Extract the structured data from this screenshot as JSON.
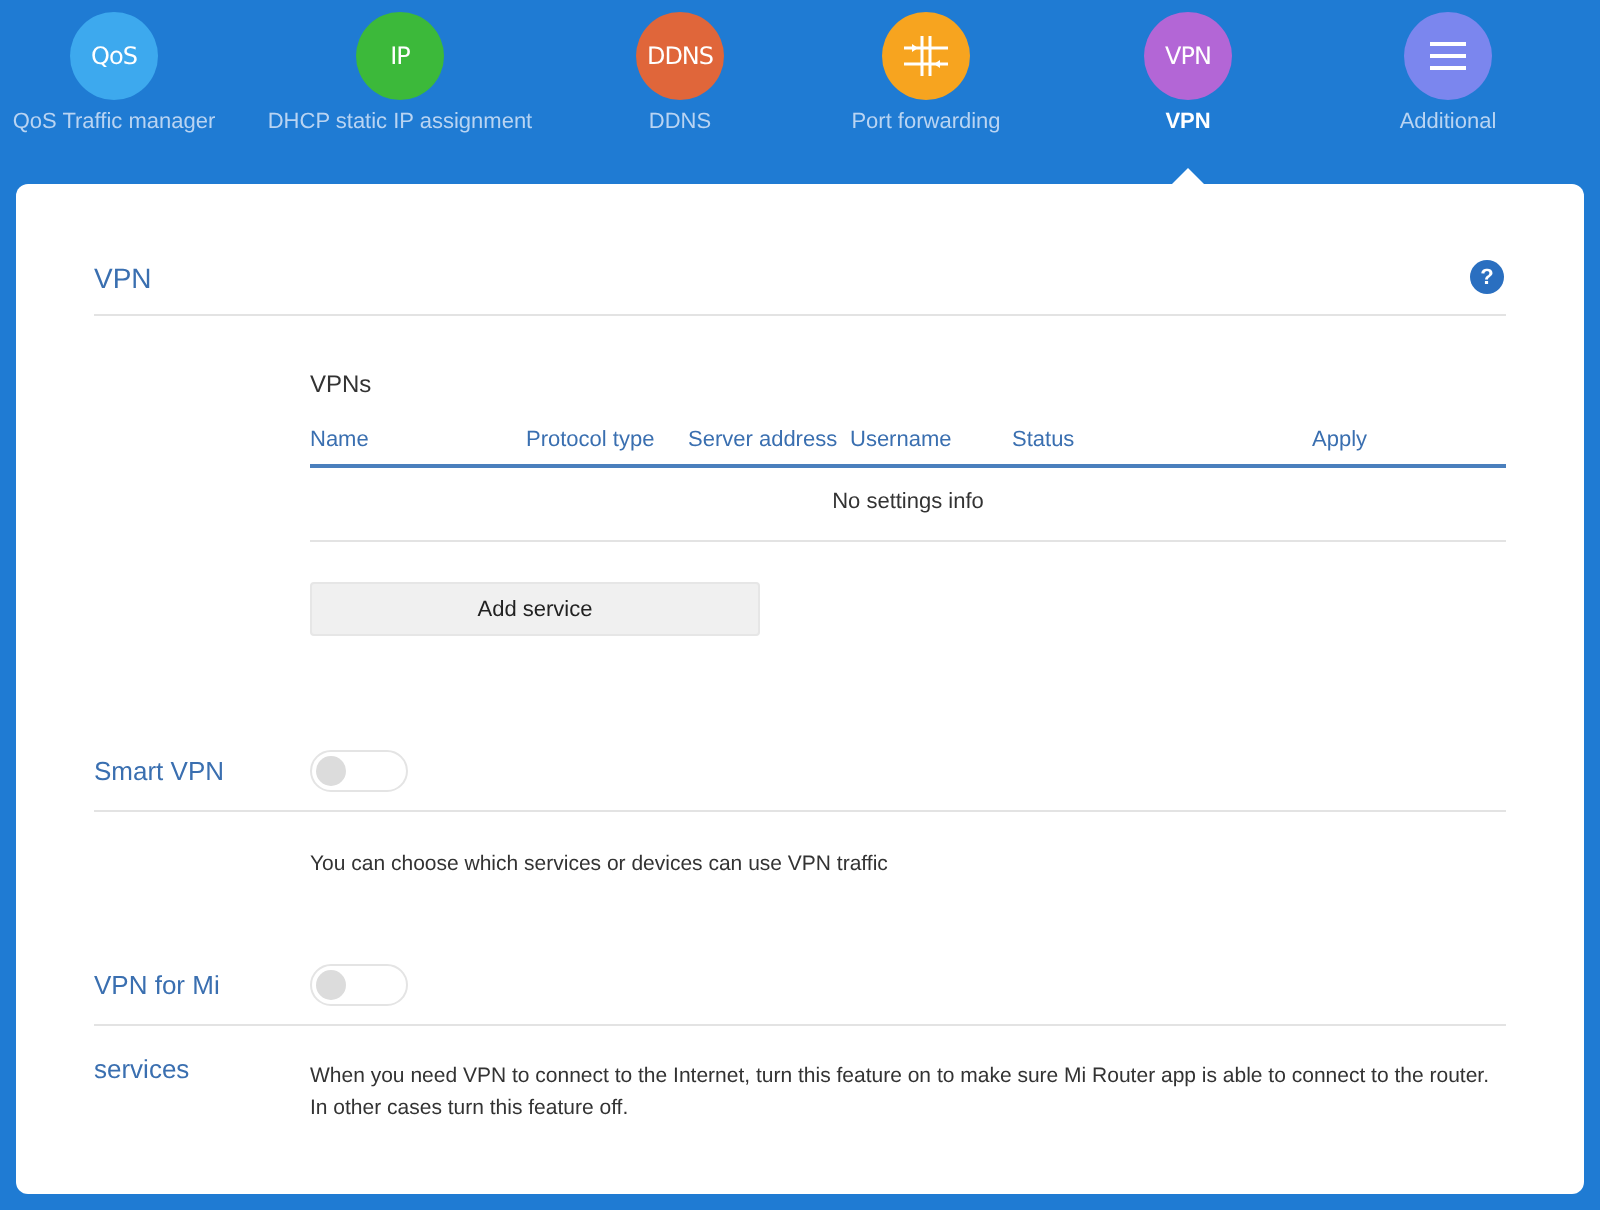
{
  "nav": [
    {
      "kind": "text",
      "glyph": "QoS",
      "label": "QoS Traffic manager",
      "color": "#3da9ee",
      "selected": false
    },
    {
      "kind": "text",
      "glyph": "IP",
      "label": "DHCP static IP assignment",
      "color": "#3cb93a",
      "selected": false
    },
    {
      "kind": "text",
      "glyph": "DDNS",
      "label": "DDNS",
      "color": "#e0663a",
      "selected": false
    },
    {
      "kind": "ports",
      "label": "Port forwarding",
      "color": "#f7a41f",
      "selected": false
    },
    {
      "kind": "text",
      "glyph": "VPN",
      "label": "VPN",
      "color": "#b366d6",
      "selected": true
    },
    {
      "kind": "menu",
      "label": "Additional",
      "color": "#7b86ee",
      "selected": false
    }
  ],
  "section": {
    "title": "VPN",
    "help": "?"
  },
  "table": {
    "title": "VPNs",
    "columns": [
      "Name",
      "Protocol type",
      "Server address",
      "Username",
      "Status",
      "Apply"
    ],
    "empty": "No settings info"
  },
  "add_button": "Add service",
  "settings": [
    {
      "label": "Smart VPN",
      "on": false,
      "description": "You can choose which services or devices can use VPN traffic"
    },
    {
      "label": "VPN for Mi",
      "label_continued": "services",
      "on": false,
      "description": "When you need VPN to connect to the Internet, turn this feature on to make sure Mi Router app is able to connect to the router. In other cases turn this feature off."
    }
  ]
}
